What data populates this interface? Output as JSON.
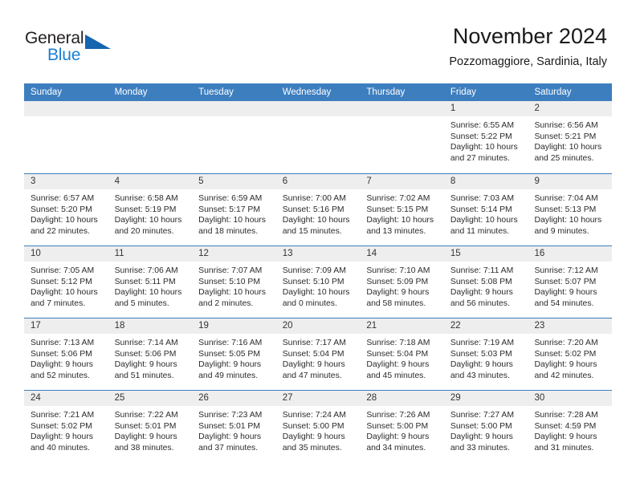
{
  "brand": {
    "name_part1": "General",
    "name_part2": "Blue",
    "triangle_color": "#1565b0",
    "blue_color": "#1b7fd4"
  },
  "header": {
    "title": "November 2024",
    "subtitle": "Pozzomaggiore, Sardinia, Italy"
  },
  "theme": {
    "header_blue": "#3d7ebf",
    "day_band_gray": "#eeeeee",
    "text_color": "#2b2b2b"
  },
  "weekdays": [
    "Sunday",
    "Monday",
    "Tuesday",
    "Wednesday",
    "Thursday",
    "Friday",
    "Saturday"
  ],
  "weeks": [
    [
      {
        "day": "",
        "sunrise": "",
        "sunset": "",
        "daylight_line1": "",
        "daylight_line2": ""
      },
      {
        "day": "",
        "sunrise": "",
        "sunset": "",
        "daylight_line1": "",
        "daylight_line2": ""
      },
      {
        "day": "",
        "sunrise": "",
        "sunset": "",
        "daylight_line1": "",
        "daylight_line2": ""
      },
      {
        "day": "",
        "sunrise": "",
        "sunset": "",
        "daylight_line1": "",
        "daylight_line2": ""
      },
      {
        "day": "",
        "sunrise": "",
        "sunset": "",
        "daylight_line1": "",
        "daylight_line2": ""
      },
      {
        "day": "1",
        "sunrise": "Sunrise: 6:55 AM",
        "sunset": "Sunset: 5:22 PM",
        "daylight_line1": "Daylight: 10 hours",
        "daylight_line2": "and 27 minutes."
      },
      {
        "day": "2",
        "sunrise": "Sunrise: 6:56 AM",
        "sunset": "Sunset: 5:21 PM",
        "daylight_line1": "Daylight: 10 hours",
        "daylight_line2": "and 25 minutes."
      }
    ],
    [
      {
        "day": "3",
        "sunrise": "Sunrise: 6:57 AM",
        "sunset": "Sunset: 5:20 PM",
        "daylight_line1": "Daylight: 10 hours",
        "daylight_line2": "and 22 minutes."
      },
      {
        "day": "4",
        "sunrise": "Sunrise: 6:58 AM",
        "sunset": "Sunset: 5:19 PM",
        "daylight_line1": "Daylight: 10 hours",
        "daylight_line2": "and 20 minutes."
      },
      {
        "day": "5",
        "sunrise": "Sunrise: 6:59 AM",
        "sunset": "Sunset: 5:17 PM",
        "daylight_line1": "Daylight: 10 hours",
        "daylight_line2": "and 18 minutes."
      },
      {
        "day": "6",
        "sunrise": "Sunrise: 7:00 AM",
        "sunset": "Sunset: 5:16 PM",
        "daylight_line1": "Daylight: 10 hours",
        "daylight_line2": "and 15 minutes."
      },
      {
        "day": "7",
        "sunrise": "Sunrise: 7:02 AM",
        "sunset": "Sunset: 5:15 PM",
        "daylight_line1": "Daylight: 10 hours",
        "daylight_line2": "and 13 minutes."
      },
      {
        "day": "8",
        "sunrise": "Sunrise: 7:03 AM",
        "sunset": "Sunset: 5:14 PM",
        "daylight_line1": "Daylight: 10 hours",
        "daylight_line2": "and 11 minutes."
      },
      {
        "day": "9",
        "sunrise": "Sunrise: 7:04 AM",
        "sunset": "Sunset: 5:13 PM",
        "daylight_line1": "Daylight: 10 hours",
        "daylight_line2": "and 9 minutes."
      }
    ],
    [
      {
        "day": "10",
        "sunrise": "Sunrise: 7:05 AM",
        "sunset": "Sunset: 5:12 PM",
        "daylight_line1": "Daylight: 10 hours",
        "daylight_line2": "and 7 minutes."
      },
      {
        "day": "11",
        "sunrise": "Sunrise: 7:06 AM",
        "sunset": "Sunset: 5:11 PM",
        "daylight_line1": "Daylight: 10 hours",
        "daylight_line2": "and 5 minutes."
      },
      {
        "day": "12",
        "sunrise": "Sunrise: 7:07 AM",
        "sunset": "Sunset: 5:10 PM",
        "daylight_line1": "Daylight: 10 hours",
        "daylight_line2": "and 2 minutes."
      },
      {
        "day": "13",
        "sunrise": "Sunrise: 7:09 AM",
        "sunset": "Sunset: 5:10 PM",
        "daylight_line1": "Daylight: 10 hours",
        "daylight_line2": "and 0 minutes."
      },
      {
        "day": "14",
        "sunrise": "Sunrise: 7:10 AM",
        "sunset": "Sunset: 5:09 PM",
        "daylight_line1": "Daylight: 9 hours",
        "daylight_line2": "and 58 minutes."
      },
      {
        "day": "15",
        "sunrise": "Sunrise: 7:11 AM",
        "sunset": "Sunset: 5:08 PM",
        "daylight_line1": "Daylight: 9 hours",
        "daylight_line2": "and 56 minutes."
      },
      {
        "day": "16",
        "sunrise": "Sunrise: 7:12 AM",
        "sunset": "Sunset: 5:07 PM",
        "daylight_line1": "Daylight: 9 hours",
        "daylight_line2": "and 54 minutes."
      }
    ],
    [
      {
        "day": "17",
        "sunrise": "Sunrise: 7:13 AM",
        "sunset": "Sunset: 5:06 PM",
        "daylight_line1": "Daylight: 9 hours",
        "daylight_line2": "and 52 minutes."
      },
      {
        "day": "18",
        "sunrise": "Sunrise: 7:14 AM",
        "sunset": "Sunset: 5:06 PM",
        "daylight_line1": "Daylight: 9 hours",
        "daylight_line2": "and 51 minutes."
      },
      {
        "day": "19",
        "sunrise": "Sunrise: 7:16 AM",
        "sunset": "Sunset: 5:05 PM",
        "daylight_line1": "Daylight: 9 hours",
        "daylight_line2": "and 49 minutes."
      },
      {
        "day": "20",
        "sunrise": "Sunrise: 7:17 AM",
        "sunset": "Sunset: 5:04 PM",
        "daylight_line1": "Daylight: 9 hours",
        "daylight_line2": "and 47 minutes."
      },
      {
        "day": "21",
        "sunrise": "Sunrise: 7:18 AM",
        "sunset": "Sunset: 5:04 PM",
        "daylight_line1": "Daylight: 9 hours",
        "daylight_line2": "and 45 minutes."
      },
      {
        "day": "22",
        "sunrise": "Sunrise: 7:19 AM",
        "sunset": "Sunset: 5:03 PM",
        "daylight_line1": "Daylight: 9 hours",
        "daylight_line2": "and 43 minutes."
      },
      {
        "day": "23",
        "sunrise": "Sunrise: 7:20 AM",
        "sunset": "Sunset: 5:02 PM",
        "daylight_line1": "Daylight: 9 hours",
        "daylight_line2": "and 42 minutes."
      }
    ],
    [
      {
        "day": "24",
        "sunrise": "Sunrise: 7:21 AM",
        "sunset": "Sunset: 5:02 PM",
        "daylight_line1": "Daylight: 9 hours",
        "daylight_line2": "and 40 minutes."
      },
      {
        "day": "25",
        "sunrise": "Sunrise: 7:22 AM",
        "sunset": "Sunset: 5:01 PM",
        "daylight_line1": "Daylight: 9 hours",
        "daylight_line2": "and 38 minutes."
      },
      {
        "day": "26",
        "sunrise": "Sunrise: 7:23 AM",
        "sunset": "Sunset: 5:01 PM",
        "daylight_line1": "Daylight: 9 hours",
        "daylight_line2": "and 37 minutes."
      },
      {
        "day": "27",
        "sunrise": "Sunrise: 7:24 AM",
        "sunset": "Sunset: 5:00 PM",
        "daylight_line1": "Daylight: 9 hours",
        "daylight_line2": "and 35 minutes."
      },
      {
        "day": "28",
        "sunrise": "Sunrise: 7:26 AM",
        "sunset": "Sunset: 5:00 PM",
        "daylight_line1": "Daylight: 9 hours",
        "daylight_line2": "and 34 minutes."
      },
      {
        "day": "29",
        "sunrise": "Sunrise: 7:27 AM",
        "sunset": "Sunset: 5:00 PM",
        "daylight_line1": "Daylight: 9 hours",
        "daylight_line2": "and 33 minutes."
      },
      {
        "day": "30",
        "sunrise": "Sunrise: 7:28 AM",
        "sunset": "Sunset: 4:59 PM",
        "daylight_line1": "Daylight: 9 hours",
        "daylight_line2": "and 31 minutes."
      }
    ]
  ]
}
